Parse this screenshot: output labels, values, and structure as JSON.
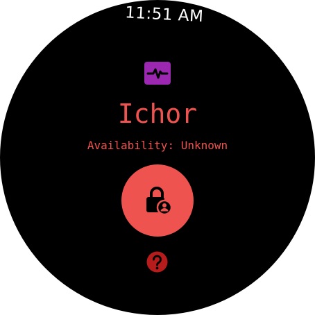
{
  "status_bar": {
    "time": "11:51 AM"
  },
  "app": {
    "name": "Ichor",
    "icon": "heart-rate-monitor-icon",
    "availability_text": "Availability: Unknown"
  },
  "actions": {
    "lock_button_icon": "lock-person-icon",
    "help_button_icon": "help-icon"
  },
  "colors": {
    "background": "#000000",
    "accent": "#EF5350",
    "icon_purple": "#9C27B0",
    "help_red": "#B71C1C",
    "time_text": "#FFFFFF"
  }
}
